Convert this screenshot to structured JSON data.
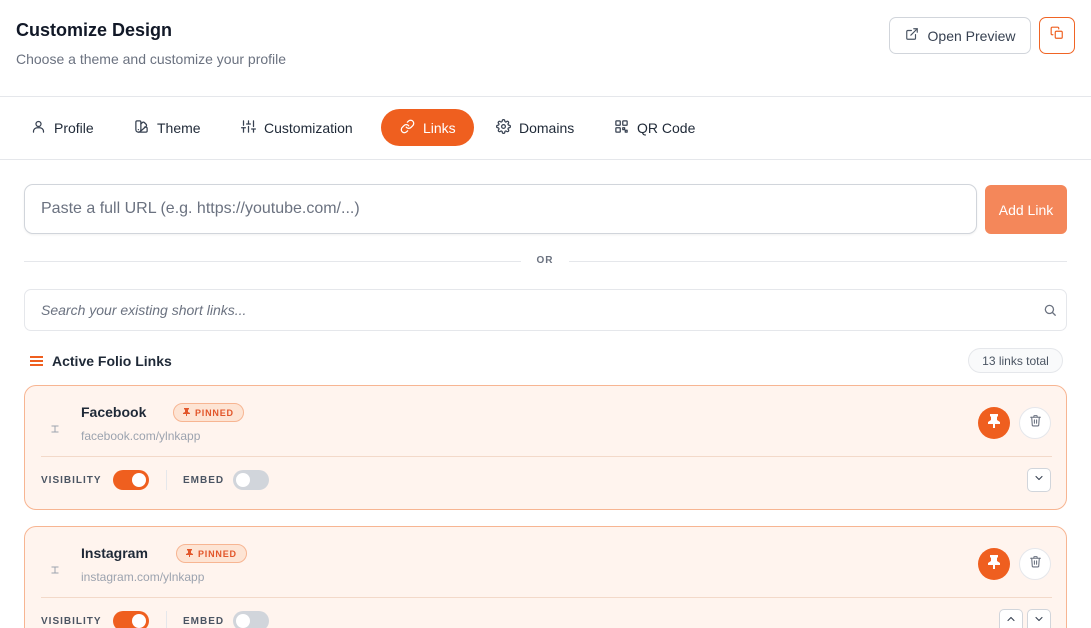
{
  "header": {
    "title": "Customize Design",
    "subtitle": "Choose a theme and customize your profile",
    "open_preview_label": "Open Preview"
  },
  "tabs": [
    {
      "label": "Profile",
      "icon": "user-icon",
      "active": false
    },
    {
      "label": "Theme",
      "icon": "swatch-book-icon",
      "active": false
    },
    {
      "label": "Customization",
      "icon": "sliders-icon",
      "active": false
    },
    {
      "label": "Links",
      "icon": "link-icon",
      "active": true
    },
    {
      "label": "Domains",
      "icon": "gear-icon",
      "active": false
    },
    {
      "label": "QR Code",
      "icon": "qr-code-icon",
      "active": false
    }
  ],
  "add_link": {
    "placeholder": "Paste a full URL (e.g. https://youtube.com/...)",
    "value": "",
    "button_label": "Add Link"
  },
  "divider_label": "OR",
  "search": {
    "placeholder": "Search your existing short links...",
    "value": ""
  },
  "links_section": {
    "title": "Active Folio Links",
    "count_label": "13 links total"
  },
  "links": [
    {
      "name": "Facebook",
      "url": "facebook.com/ylnkapp",
      "pinned_label": "PINNED",
      "visibility_label": "VISIBILITY",
      "visibility_on": true,
      "embed_label": "EMBED",
      "embed_on": false
    },
    {
      "name": "Instagram",
      "url": "instagram.com/ylnkapp",
      "pinned_label": "PINNED",
      "visibility_label": "VISIBILITY",
      "visibility_on": true,
      "embed_label": "EMBED",
      "embed_on": false
    }
  ],
  "colors": {
    "accent": "#ef5f1f",
    "accent_light": "#f4875a",
    "card_bg": "#fff4ee",
    "card_border": "#f7b592"
  }
}
